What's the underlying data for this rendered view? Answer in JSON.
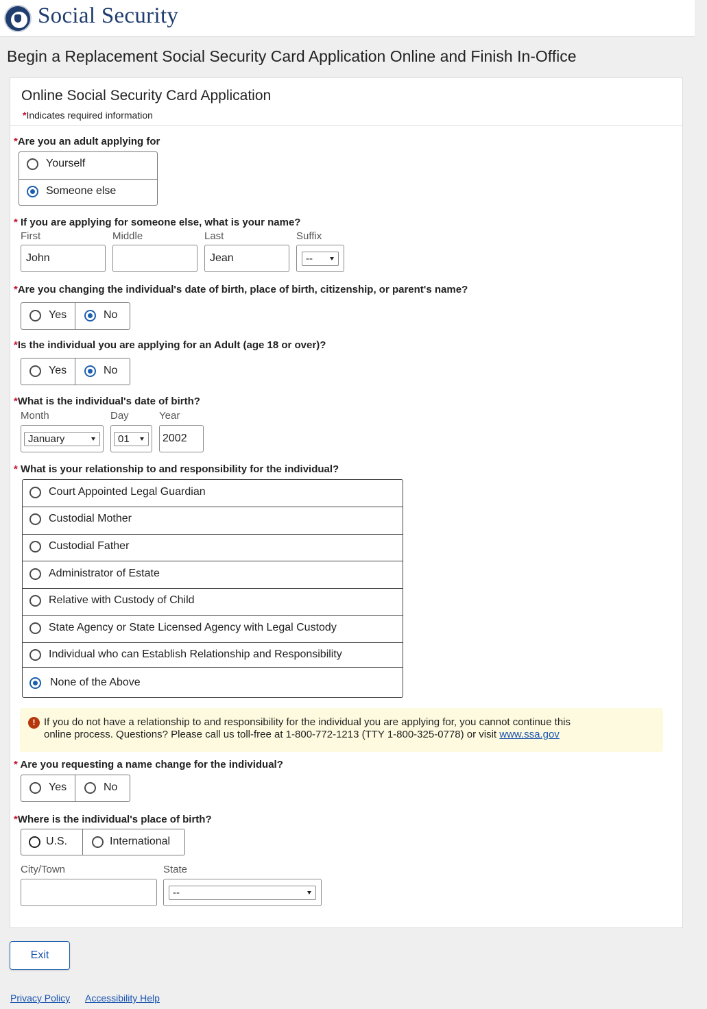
{
  "header": {
    "brand": "Social Security",
    "logo_icon": "ssa-seal-icon"
  },
  "page_title": "Begin a Replacement Social Security Card Application Online and Finish In-Office",
  "card": {
    "title": "Online Social Security Card Application",
    "required_marker": "*",
    "required_note": "Indicates required information"
  },
  "q1": {
    "label": "Are you an adult applying for",
    "options": [
      {
        "label": "Yourself",
        "checked": false
      },
      {
        "label": "Someone else",
        "checked": true
      }
    ]
  },
  "q2": {
    "label": "If you are applying for someone else, what is your name?",
    "first_label": "First",
    "middle_label": "Middle",
    "last_label": "Last",
    "suffix_label": "Suffix",
    "first_value": "John",
    "middle_value": "",
    "last_value": "Jean",
    "suffix_value": "--"
  },
  "q3": {
    "label": "Are you changing the individual's date of birth, place of birth, citizenship, or parent's name?",
    "yes_label": "Yes",
    "no_label": "No",
    "selected": "No"
  },
  "q4": {
    "label": "Is the individual you are applying for an Adult (age 18 or over)?",
    "yes_label": "Yes",
    "no_label": "No",
    "selected": "No"
  },
  "q5": {
    "label": "What is the individual's date of birth?",
    "month_label": "Month",
    "day_label": "Day",
    "year_label": "Year",
    "month_value": "January",
    "day_value": "01",
    "year_value": "2002"
  },
  "q6": {
    "label": "What is your relationship to and responsibility for the individual?",
    "options": [
      {
        "label": "Court Appointed Legal Guardian",
        "checked": false
      },
      {
        "label": "Custodial Mother",
        "checked": false
      },
      {
        "label": "Custodial Father",
        "checked": false
      },
      {
        "label": "Administrator of Estate",
        "checked": false
      },
      {
        "label": "Relative with Custody of Child",
        "checked": false
      },
      {
        "label": "State Agency or State Licensed Agency with Legal Custody",
        "checked": false
      },
      {
        "label": "Individual who can Establish Relationship and Responsibility",
        "checked": false
      },
      {
        "label": "None of the Above",
        "checked": true
      }
    ]
  },
  "warning": {
    "icon": "exclamation-icon",
    "line1": "If you do not have a relationship to and responsibility for the individual you are applying for, you cannot continue this",
    "line2": "online process.  Questions? Please call us toll-free at 1-800-772-1213 (TTY 1-800-325-0778) or visit ",
    "link_text": "www.ssa.gov"
  },
  "q7": {
    "label": "Are you requesting a name change for the individual?",
    "yes_label": "Yes",
    "no_label": "No",
    "selected": ""
  },
  "q8": {
    "label": "Where is the individual's place of birth?",
    "us_label": "U.S.",
    "intl_label": "International",
    "selected": "",
    "city_label": "City/Town",
    "state_label": "State",
    "city_value": "",
    "state_value": "--"
  },
  "exit_label": "Exit",
  "footer": {
    "privacy": "Privacy Policy",
    "accessibility": "Accessibility Help"
  },
  "colors": {
    "brand": "#1f3d6e",
    "accent": "#1b5fae",
    "required": "#c8102e",
    "warning_bg": "#fdfadf"
  }
}
